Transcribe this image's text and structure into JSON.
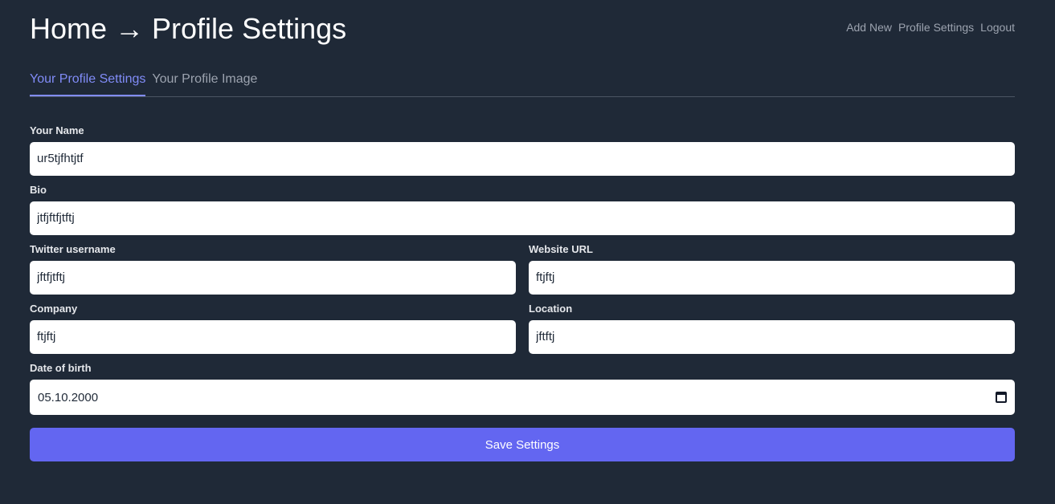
{
  "header": {
    "title": "Home → Profile Settings",
    "nav": [
      "Add New",
      "Profile Settings",
      "Logout"
    ]
  },
  "tabs": [
    {
      "label": "Your Profile Settings",
      "active": true
    },
    {
      "label": "Your Profile Image",
      "active": false
    }
  ],
  "form": {
    "name": {
      "label": "Your Name",
      "value": "ur5tjfhtjtf"
    },
    "bio": {
      "label": "Bio",
      "value": "jtfjftfjtftj"
    },
    "twitter": {
      "label": "Twitter username",
      "value": "jftfjtftj"
    },
    "website": {
      "label": "Website URL",
      "value": "ftjftj"
    },
    "company": {
      "label": "Company",
      "value": "ftjftj"
    },
    "location": {
      "label": "Location",
      "value": "jftftj"
    },
    "dob": {
      "label": "Date of birth",
      "value": "05.10.2000"
    },
    "save_label": "Save Settings"
  },
  "colors": {
    "background": "#1f2937",
    "accent": "#6366f1",
    "tab_active": "#818cf8"
  },
  "icons": {
    "date_picker": "calendar-icon"
  }
}
